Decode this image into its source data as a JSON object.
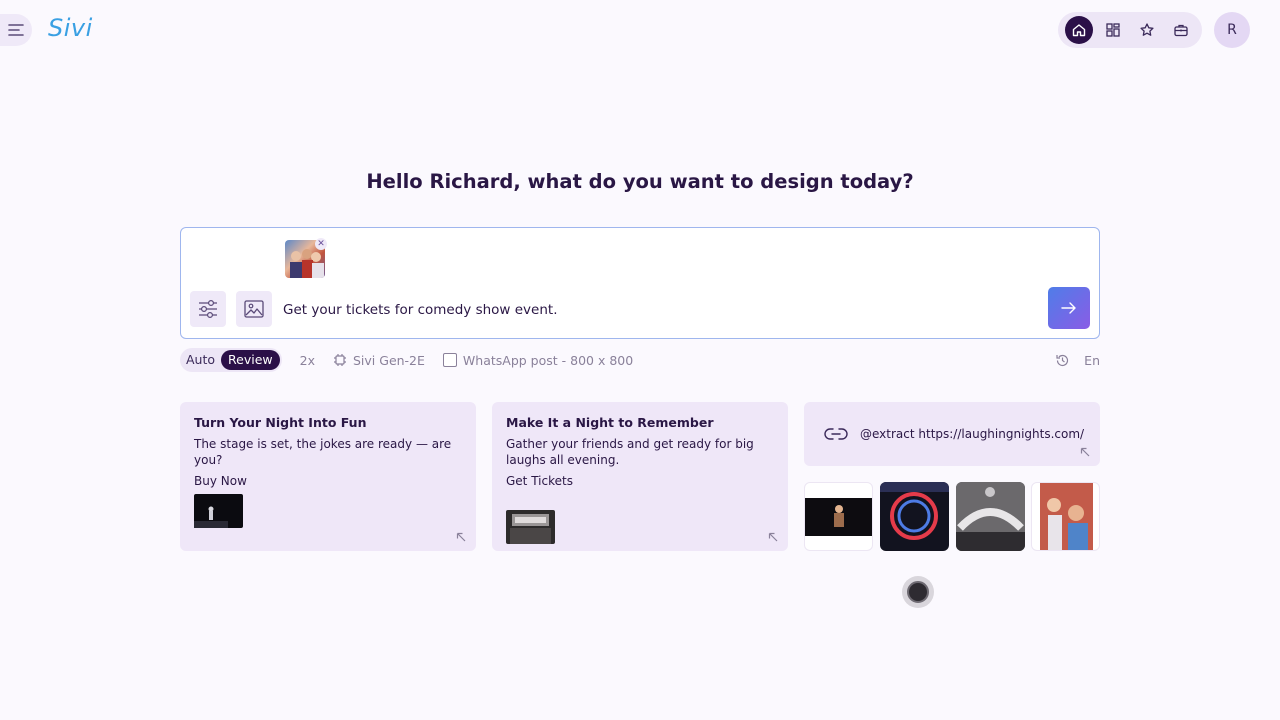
{
  "app": {
    "logo_text": "Sivi"
  },
  "header": {
    "nav_icons": [
      "home-icon",
      "grid-icon",
      "star-icon",
      "briefcase-icon"
    ],
    "avatar_initial": "R",
    "accent": "#2b1048"
  },
  "main": {
    "greeting": "Hello Richard, what do you want to design today?",
    "prompt": {
      "value": "Get your tickets for comedy show event.",
      "send_icon": "arrow-right-icon"
    },
    "options": {
      "mode_auto": "Auto",
      "mode_review": "Review",
      "multiplier": "2x",
      "model": "Sivi Gen-2E",
      "format": "WhatsApp post - 800 x 800",
      "language": "En"
    },
    "suggestions": [
      {
        "title": "Turn Your Night Into Fun",
        "description": "The stage is set, the jokes are ready — are you?",
        "cta": "Buy Now"
      },
      {
        "title": "Make It a Night to Remember",
        "description": "Gather your friends and get ready for big laughs all evening.",
        "cta": "Get Tickets"
      }
    ],
    "extract": {
      "text": "@extract https://laughingnights.com/"
    }
  }
}
